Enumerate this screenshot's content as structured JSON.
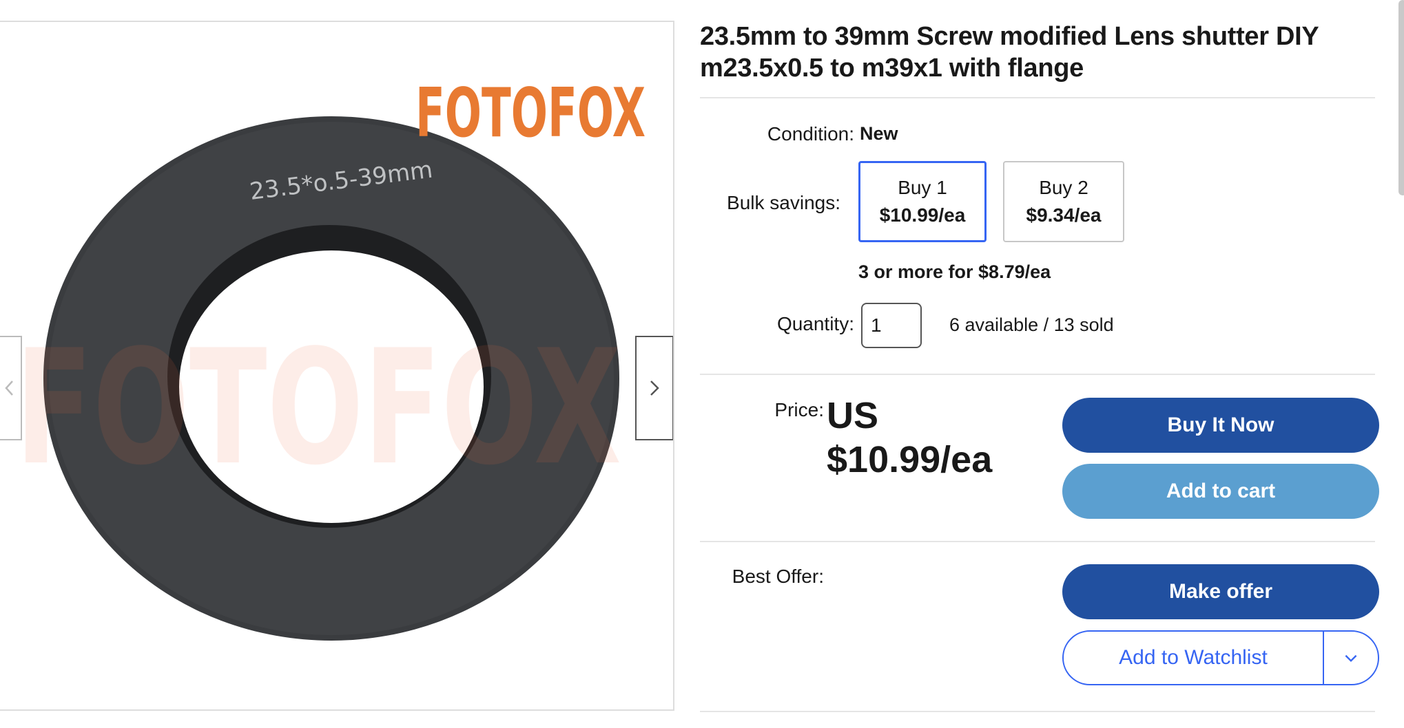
{
  "gallery": {
    "brand_text": "FOTOFOX",
    "watermark_text": "FOTOFOX",
    "ring_engraving": "23.5*o.5-39mm",
    "prev_icon": "chevron-left-icon",
    "next_icon": "chevron-right-icon"
  },
  "product": {
    "title": "23.5mm to 39mm Screw modified Lens shutter DIY m23.5x0.5 to m39x1 with flange"
  },
  "condition": {
    "label": "Condition:",
    "value": "New"
  },
  "bulk": {
    "label": "Bulk savings:",
    "options": [
      {
        "qty": "Buy 1",
        "price": "$10.99/ea",
        "selected": true
      },
      {
        "qty": "Buy 2",
        "price": "$9.34/ea",
        "selected": false
      }
    ],
    "more": "3 or more for $8.79/ea"
  },
  "quantity": {
    "label": "Quantity:",
    "value": "1",
    "availability": "6 available / 13 sold"
  },
  "price": {
    "label": "Price:",
    "currency": "US",
    "amount": "$10.99/ea"
  },
  "actions": {
    "buy_now": "Buy It Now",
    "add_to_cart": "Add to cart",
    "make_offer": "Make offer",
    "add_to_watchlist": "Add to Watchlist",
    "watchlist_dropdown_icon": "chevron-down-icon"
  },
  "best_offer": {
    "label": "Best Offer:"
  },
  "colors": {
    "primary_button": "#2150a0",
    "secondary_button": "#5b9fd0",
    "link_blue": "#3665f3",
    "brand_orange": "#e87a32",
    "ring": "#3a3c3f"
  }
}
